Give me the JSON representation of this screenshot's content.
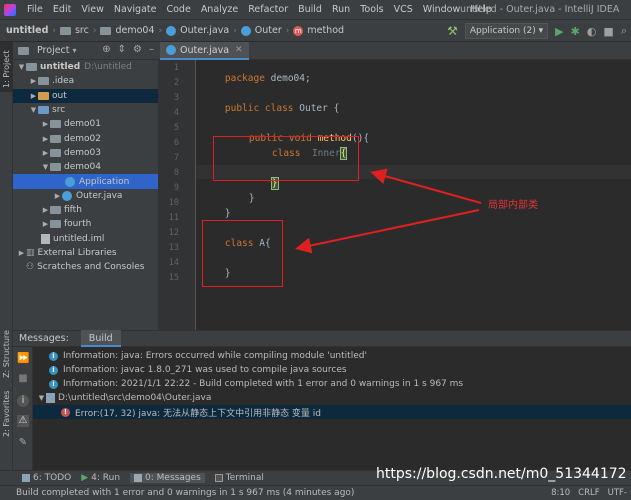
{
  "menubar": {
    "items": [
      "File",
      "Edit",
      "View",
      "Navigate",
      "Code",
      "Analyze",
      "Refactor",
      "Build",
      "Run",
      "Tools",
      "VCS",
      "Window",
      "Help"
    ],
    "window_title": "untitled - Outer.java - IntelliJ IDEA"
  },
  "navbar": {
    "crumbs": [
      "untitled",
      "src",
      "demo04",
      "Outer.java",
      "Outer",
      "method"
    ],
    "run_config": "Application (2)"
  },
  "left_strip": {
    "project_label": "1: Project",
    "structure_label": "Z: Structure",
    "favorites_label": "2: Favorites"
  },
  "project_panel": {
    "title": "Project",
    "tree": [
      {
        "label": "untitled",
        "extra": "D:\\untitled"
      },
      {
        "label": ".idea"
      },
      {
        "label": "out"
      },
      {
        "label": "src"
      },
      {
        "label": "demo01"
      },
      {
        "label": "demo02"
      },
      {
        "label": "demo03"
      },
      {
        "label": "demo04"
      },
      {
        "label": "Application"
      },
      {
        "label": "Outer.java"
      },
      {
        "label": "fifth"
      },
      {
        "label": "fourth"
      },
      {
        "label": "untitled.iml"
      },
      {
        "label": "External Libraries"
      },
      {
        "label": "Scratches and Consoles"
      }
    ]
  },
  "editor": {
    "tab_label": "Outer.java",
    "line_numbers": [
      "1",
      "2",
      "3",
      "4",
      "5",
      "6",
      "7",
      "8",
      "9",
      "10",
      "11",
      "12",
      "13",
      "14",
      "15"
    ],
    "code": {
      "l1_kw": "package",
      "l1_tx": " demo04;",
      "l3_kw": "public class",
      "l3_tx": " Outer {",
      "l5_kw": "public void",
      "l5_fn": "method",
      "l5_tx": "(){",
      "l6_kw": "class",
      "l6_cls": "Inner",
      "l6_tx": "{",
      "l8_tx": "}",
      "l9_tx": "}",
      "l10_tx": "}",
      "l12_kw": "class",
      "l12_tx": " A{",
      "l14_tx": "}"
    },
    "annotation": "局部内部类"
  },
  "bottom_panel": {
    "title": "Messages:",
    "tab": "Build",
    "messages": [
      {
        "type": "info",
        "text": "Information: java: Errors occurred while compiling module 'untitled'"
      },
      {
        "type": "info",
        "text": "Information: javac 1.8.0_271 was used to compile java sources"
      },
      {
        "type": "info",
        "text": "Information: 2021/1/1 22:22 - Build completed with 1 error and 0 warnings in 1 s 967 ms"
      },
      {
        "type": "file",
        "text": "D:\\untitled\\src\\demo04\\Outer.java"
      },
      {
        "type": "error",
        "text": "Error:(17, 32)  java: 无法从静态上下文中引用非静态 变量 id"
      }
    ]
  },
  "toolwindows": {
    "todo": "6: TODO",
    "run": "4: Run",
    "messages": "0: Messages",
    "terminal": "Terminal"
  },
  "watermark": "https://blog.csdn.net/m0_51344172",
  "statusbar": {
    "text": "Build completed with 1 error and 0 warnings in 1 s 967 ms (4 minutes ago)",
    "position": "8:10",
    "line_sep": "CRLF",
    "encoding": "UTF-"
  },
  "colors": {
    "accent": "#4a88c7",
    "annotation_red": "#e02020",
    "keyword": "#cc7832",
    "method": "#ffc66d"
  }
}
